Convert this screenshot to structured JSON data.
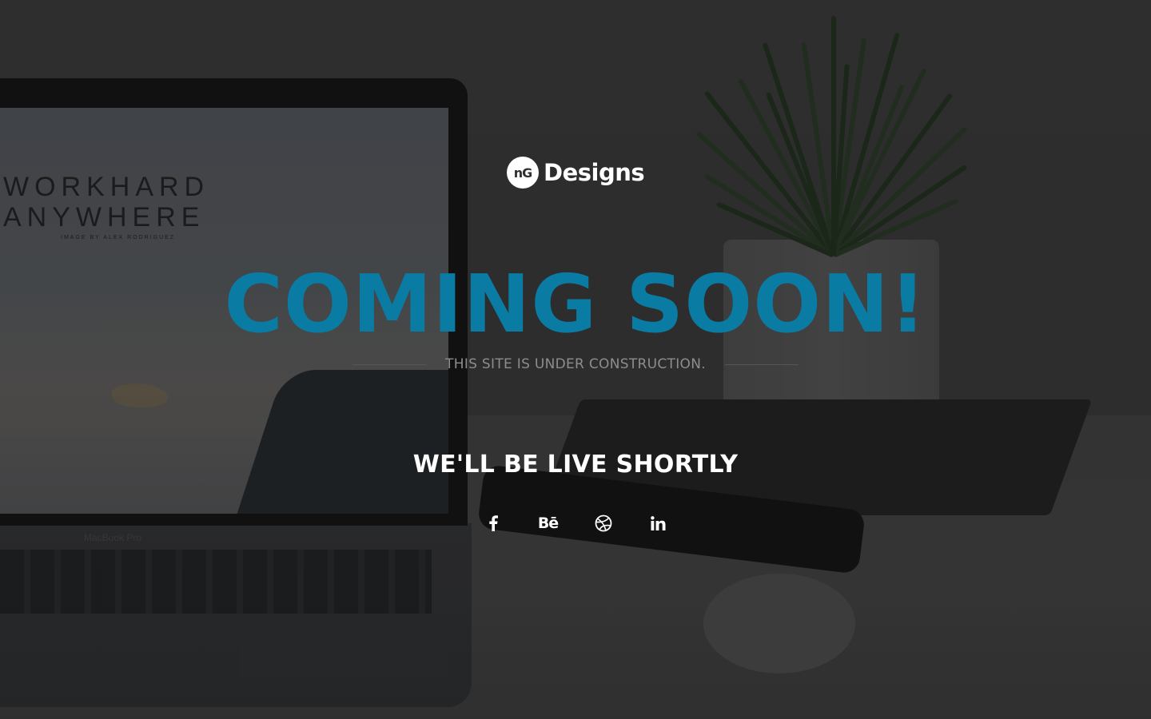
{
  "brand": {
    "badge_text": "nG",
    "name": "Designs"
  },
  "hero": {
    "headline": "COMING SOON!",
    "subline": "THIS SITE IS UNDER CONSTRUCTION.",
    "tagline": "WE'LL BE LIVE SHORTLY"
  },
  "background_photo": {
    "screen_text_line1": "WORKHARD",
    "screen_text_line2": "ANYWHERE",
    "screen_text_small": "IMAGE BY ALEX RODRIGUEZ",
    "laptop_label": "MacBook Pro"
  },
  "social": [
    {
      "icon": "facebook-icon"
    },
    {
      "icon": "behance-icon",
      "glyph": "Bē"
    },
    {
      "icon": "dribbble-icon"
    },
    {
      "icon": "linkedin-icon"
    }
  ],
  "colors": {
    "accent": "#0a7ca3",
    "background": "#2f2f31",
    "text_primary": "#ffffff",
    "text_muted": "#8d8d90"
  }
}
